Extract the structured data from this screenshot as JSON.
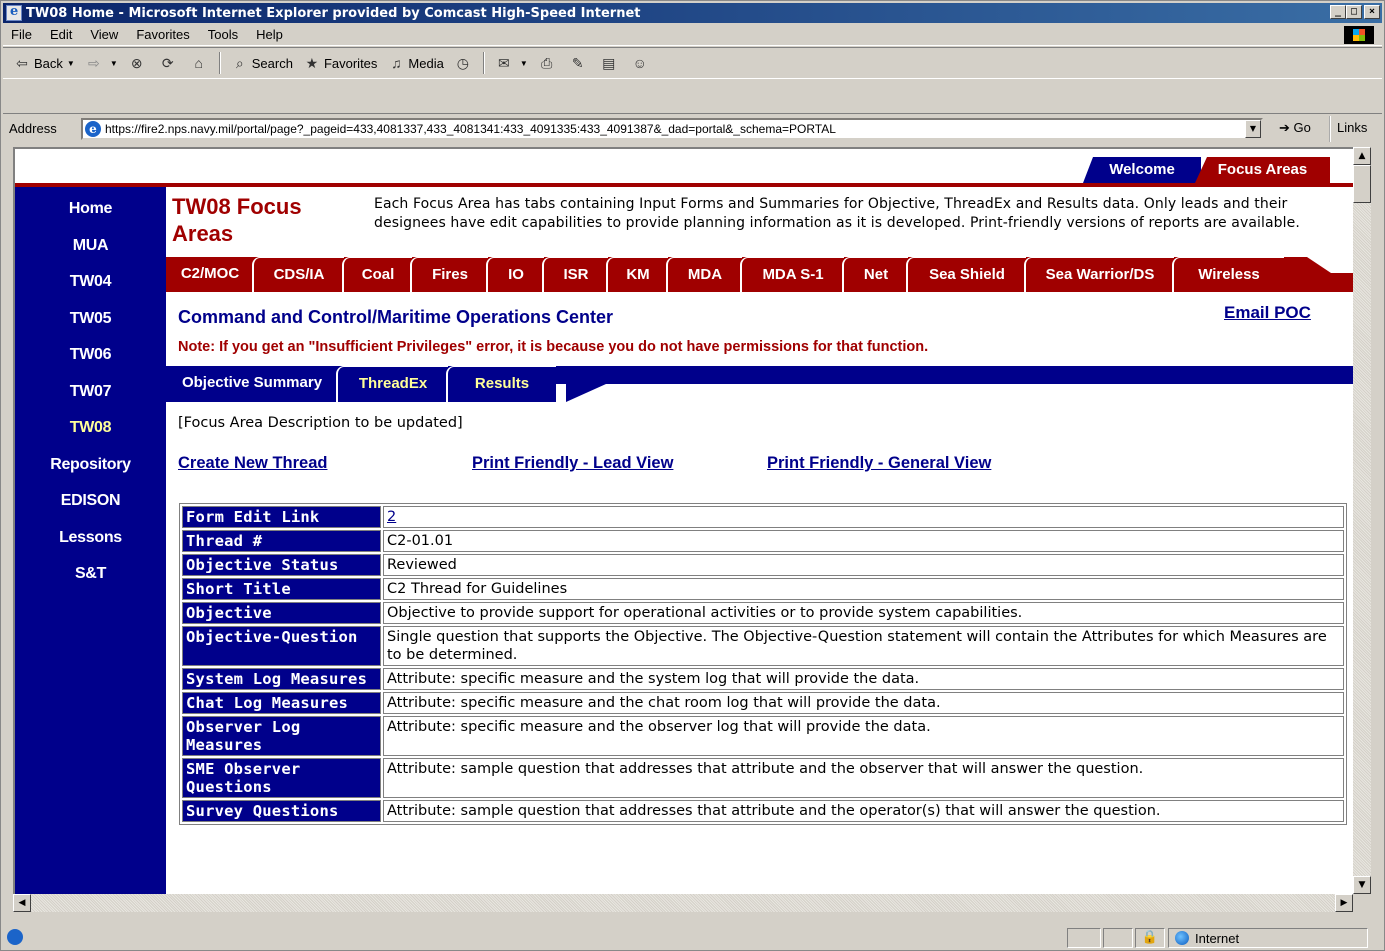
{
  "window": {
    "title": "TW08 Home - Microsoft Internet Explorer provided by Comcast High-Speed Internet"
  },
  "menu": [
    "File",
    "Edit",
    "View",
    "Favorites",
    "Tools",
    "Help"
  ],
  "toolbar": {
    "back": "Back",
    "search": "Search",
    "favorites": "Favorites",
    "media": "Media"
  },
  "address": {
    "label": "Address",
    "url": "https://fire2.nps.navy.mil/portal/page?_pageid=433,4081337,433_4081341:433_4091335:433_4091387&_dad=portal&_schema=PORTAL",
    "go": "Go",
    "links": "Links"
  },
  "status": {
    "zone": "Internet"
  },
  "portal": {
    "top_tabs": [
      "Welcome",
      "Focus Areas"
    ],
    "nav": [
      "Home",
      "MUA",
      "TW04",
      "TW05",
      "TW06",
      "TW07",
      "TW08",
      "Repository",
      "EDISON",
      "Lessons",
      "S&T"
    ],
    "nav_active": "TW08",
    "header_title": "TW08 Focus Areas",
    "header_desc": "Each Focus Area has tabs containing Input Forms and Summaries for Objective, ThreadEx and Results data. Only leads and their designees have edit capabilities to provide planning information as it is developed. Print-friendly versions of reports are available.",
    "focus_tabs": [
      "C2/MOC",
      "CDS/IA",
      "Coal",
      "Fires",
      "IO",
      "ISR",
      "KM",
      "MDA",
      "MDA S-1",
      "Net",
      "Sea Shield",
      "Sea Warrior/DS",
      "Wireless"
    ],
    "page_title": "Command and Control/Maritime Operations Center",
    "email_poc": "Email POC",
    "note": "Note: If you get an \"Insufficient Privileges\" error, it is because you do not have permissions for that function.",
    "sub_tabs": [
      "Objective Summary",
      "ThreadEx",
      "Results"
    ],
    "description": "[Focus Area Description to be updated]",
    "links": [
      "Create New Thread",
      "Print Friendly - Lead View",
      "Print Friendly - General View"
    ]
  },
  "table": [
    {
      "label": "Form Edit Link",
      "value": "2"
    },
    {
      "label": "Thread #",
      "value": "C2-01.01"
    },
    {
      "label": "Objective Status",
      "value": "Reviewed"
    },
    {
      "label": "Short Title",
      "value": "C2 Thread for Guidelines"
    },
    {
      "label": "Objective",
      "value": "Objective to provide support for operational activities or to provide system capabilities."
    },
    {
      "label": "Objective-Question",
      "value": "Single question that supports the Objective. The Objective-Question statement will contain the Attributes for which Measures are to be determined."
    },
    {
      "label": "System Log Measures",
      "value": "Attribute: specific measure and the system log that will provide the data."
    },
    {
      "label": "Chat Log Measures",
      "value": "Attribute: specific measure and the chat room log that will provide the data."
    },
    {
      "label": "Observer Log Measures",
      "value": "Attribute: specific measure and the observer log that will provide the data."
    },
    {
      "label": "SME Observer Questions",
      "value": "Attribute: sample question that addresses that attribute and the observer that will answer the question."
    },
    {
      "label": "Survey Questions",
      "value": "Attribute: sample question that addresses that attribute and the operator(s) that will answer the question."
    }
  ]
}
